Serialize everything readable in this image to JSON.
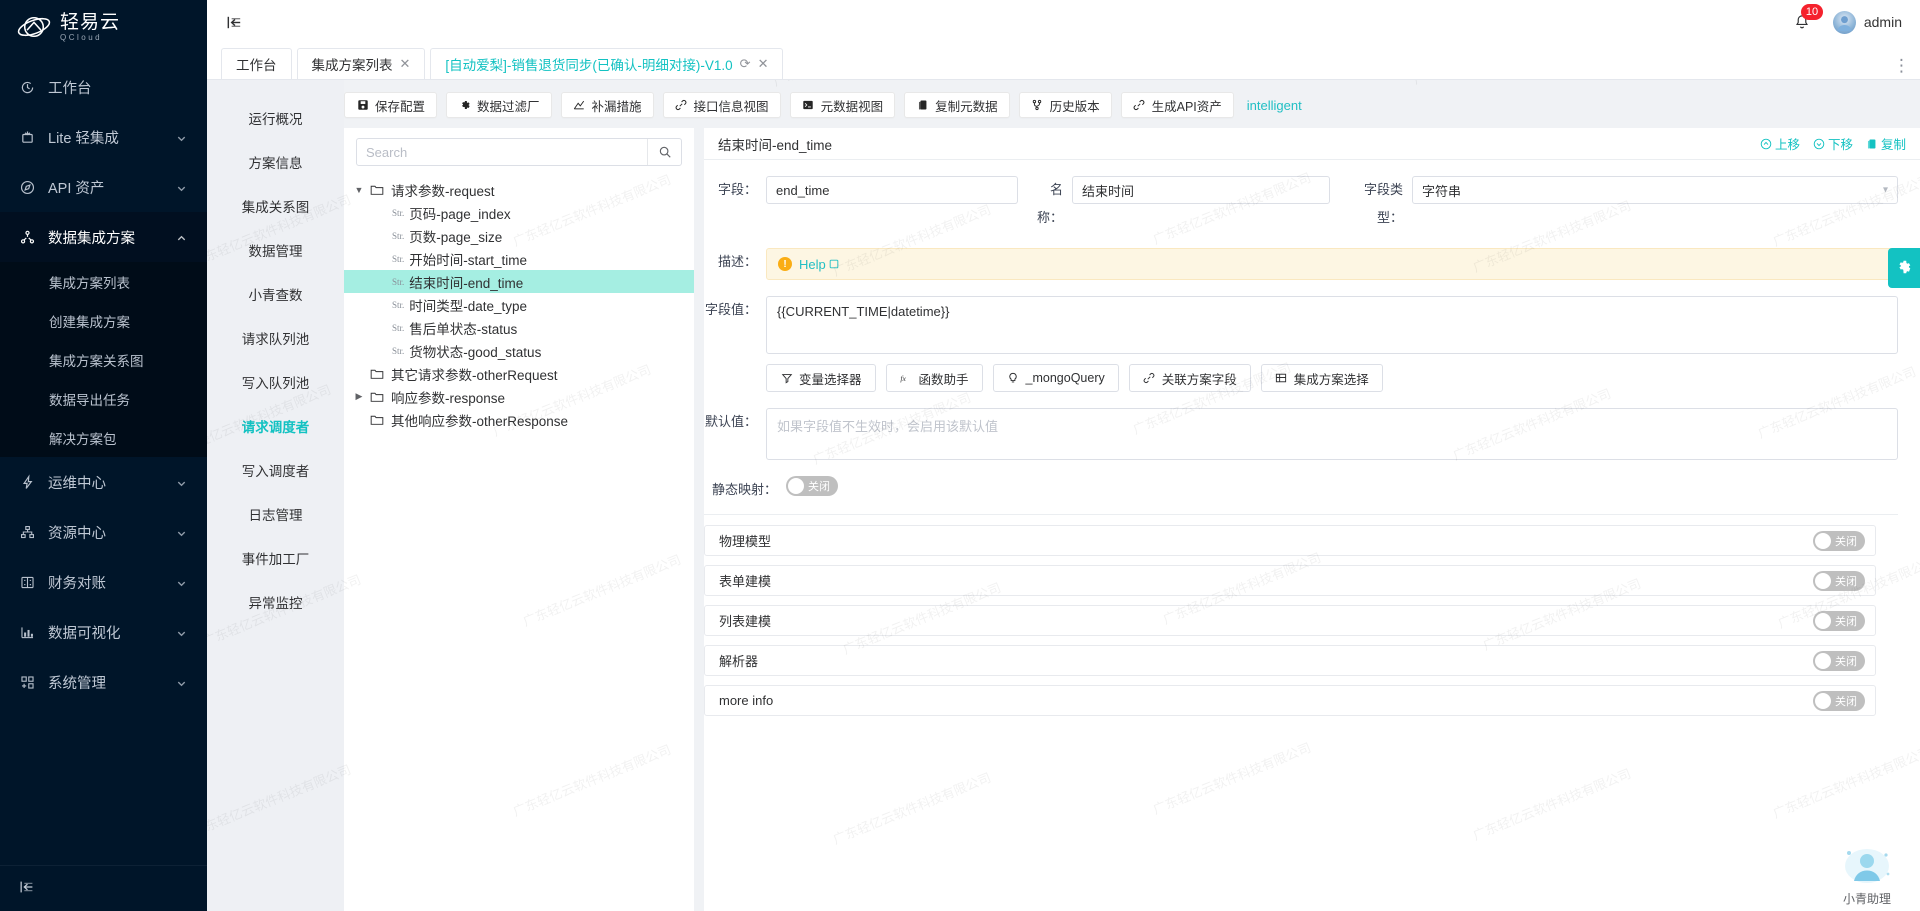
{
  "brand": {
    "name_cn": "轻易云",
    "name_en": "QCloud"
  },
  "sidebar": {
    "items": [
      {
        "label": "工作台",
        "icon": "clock-icon",
        "expandable": false
      },
      {
        "label": "Lite 轻集成",
        "icon": "lite-icon",
        "expandable": true
      },
      {
        "label": "API 资产",
        "icon": "compass-icon",
        "expandable": true
      },
      {
        "label": "数据集成方案",
        "icon": "nodes-icon",
        "expandable": true,
        "expanded": true
      },
      {
        "label": "运维中心",
        "icon": "lightning-icon",
        "expandable": true
      },
      {
        "label": "资源中心",
        "icon": "sitemap-icon",
        "expandable": true
      },
      {
        "label": "财务对账",
        "icon": "ledger-icon",
        "expandable": true
      },
      {
        "label": "数据可视化",
        "icon": "bar-chart-icon",
        "expandable": true
      },
      {
        "label": "系统管理",
        "icon": "grid-icon",
        "expandable": true
      }
    ],
    "submenu": [
      {
        "label": "集成方案列表"
      },
      {
        "label": "创建集成方案"
      },
      {
        "label": "集成方案关系图"
      },
      {
        "label": "数据导出任务"
      },
      {
        "label": "解决方案包"
      }
    ],
    "collapse_icon": "collapse-sidebar-icon"
  },
  "topbar": {
    "collapse_icon": "menu-collapse-icon",
    "notification_count": "10",
    "username": "admin",
    "more_icon": "more-vertical-icon"
  },
  "tabs": [
    {
      "label": "工作台",
      "closable": false,
      "refreshable": false,
      "active": false
    },
    {
      "label": "集成方案列表",
      "closable": true,
      "refreshable": false,
      "active": false
    },
    {
      "label": "[自动爱梨]-销售退货同步(已确认-明细对接)-V1.0",
      "closable": true,
      "refreshable": true,
      "active": true
    }
  ],
  "subnav": {
    "items": [
      {
        "label": "运行概况",
        "active": false
      },
      {
        "label": "方案信息",
        "active": false
      },
      {
        "label": "集成关系图",
        "active": false
      },
      {
        "label": "数据管理",
        "active": false
      },
      {
        "label": "小青查数",
        "active": false
      },
      {
        "label": "请求队列池",
        "active": false
      },
      {
        "label": "写入队列池",
        "active": false
      },
      {
        "label": "请求调度者",
        "active": true
      },
      {
        "label": "写入调度者",
        "active": false
      },
      {
        "label": "日志管理",
        "active": false
      },
      {
        "label": "事件加工厂",
        "active": false
      },
      {
        "label": "异常监控",
        "active": false
      }
    ]
  },
  "toolbar": {
    "buttons": [
      {
        "label": "保存配置",
        "icon": "save-icon"
      },
      {
        "label": "数据过滤厂",
        "icon": "gear-icon"
      },
      {
        "label": "补漏措施",
        "icon": "trend-icon"
      },
      {
        "label": "接口信息视图",
        "icon": "link-icon"
      },
      {
        "label": "元数据视图",
        "icon": "terminal-icon"
      },
      {
        "label": "复制元数据",
        "icon": "copy-icon"
      },
      {
        "label": "历史版本",
        "icon": "branch-icon"
      },
      {
        "label": "生成API资产",
        "icon": "link-icon"
      }
    ],
    "link": "intelligent"
  },
  "tree": {
    "search_placeholder": "Search",
    "search_value": "",
    "search_icon": "search-icon",
    "nodes": [
      {
        "level": 1,
        "type": "folder",
        "expanded": true,
        "label": "请求参数-request"
      },
      {
        "level": 2,
        "type": "str",
        "label": "页码-page_index"
      },
      {
        "level": 2,
        "type": "str",
        "label": "页数-page_size"
      },
      {
        "level": 2,
        "type": "str",
        "label": "开始时间-start_time"
      },
      {
        "level": 2,
        "type": "str",
        "label": "结束时间-end_time",
        "selected": true
      },
      {
        "level": 2,
        "type": "str",
        "label": "时间类型-date_type"
      },
      {
        "level": 2,
        "type": "str",
        "label": "售后单状态-status"
      },
      {
        "level": 2,
        "type": "str",
        "label": "货物状态-good_status"
      },
      {
        "level": 1,
        "type": "folder",
        "expanded": false,
        "label": "其它请求参数-otherRequest"
      },
      {
        "level": 1,
        "type": "folder",
        "expanded": false,
        "collapsed_caret": true,
        "label": "响应参数-response"
      },
      {
        "level": 1,
        "type": "folder",
        "expanded": false,
        "label": "其他响应参数-otherResponse"
      }
    ]
  },
  "detail": {
    "title": "结束时间-end_time",
    "actions": [
      {
        "label": "上移",
        "icon": "arrow-up-circle-icon"
      },
      {
        "label": "下移",
        "icon": "arrow-down-circle-icon"
      },
      {
        "label": "复制",
        "icon": "copy-icon"
      }
    ],
    "field_label": "字段：",
    "field_value": "end_time",
    "name_label": "名称：",
    "name_value": "结束时间",
    "type_label": "字段类型：",
    "type_value": "字符串",
    "desc_label": "描述：",
    "desc_help": "Help",
    "desc_warn_icon": "warning-icon",
    "desc_external_icon": "external-link-icon",
    "value_label": "字段值：",
    "value_value": "{{CURRENT_TIME|datetime}}",
    "value_buttons": [
      {
        "label": "变量选择器",
        "icon": "filter-icon"
      },
      {
        "label": "函数助手",
        "icon": "fx-icon"
      },
      {
        "label": "_mongoQuery",
        "icon": "bulb-icon"
      },
      {
        "label": "关联方案字段",
        "icon": "link-icon"
      },
      {
        "label": "集成方案选择",
        "icon": "table-icon"
      }
    ],
    "default_label": "默认值：",
    "default_placeholder": "如果字段值不生效时，会启用该默认值",
    "default_value": "",
    "static_map_label": "静态映射：",
    "static_map_state": "关闭"
  },
  "panels": [
    {
      "title": "物理模型",
      "state": "关闭"
    },
    {
      "title": "表单建模",
      "state": "关闭"
    },
    {
      "title": "列表建模",
      "state": "关闭"
    },
    {
      "title": "解析器",
      "state": "关闭"
    },
    {
      "title": "more info",
      "state": "关闭"
    }
  ],
  "floating": {
    "gear_icon": "settings-gear-icon",
    "assistant_label": "小青助理",
    "assistant_icon": "assistant-avatar-icon"
  },
  "watermark": {
    "text": "广东轻亿云软件科技有限公司"
  },
  "colors": {
    "accent": "#13c2c2",
    "sidebar_bg": "#001529",
    "selected_row": "#a5eee2",
    "badge": "#f5222d"
  }
}
